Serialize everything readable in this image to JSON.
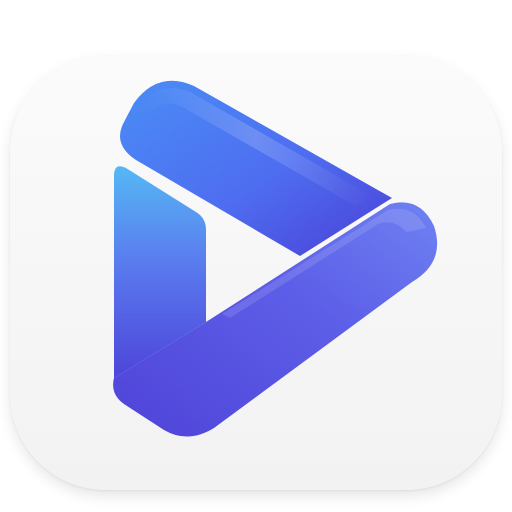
{
  "app_icon": {
    "icon_name": "play-logo-icon",
    "colors": {
      "tile_top": "#fbfbfb",
      "tile_bottom": "#f2f2f3",
      "ribbon_light_blue": "#4fb2f2",
      "ribbon_blue": "#4b86f5",
      "ribbon_indigo": "#5a4fe0",
      "ribbon_violet": "#6a72ef"
    }
  }
}
